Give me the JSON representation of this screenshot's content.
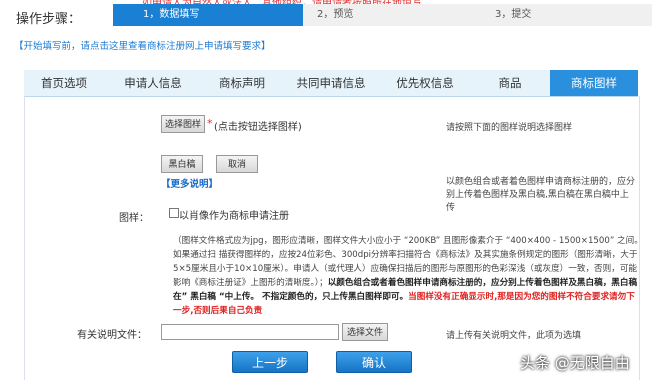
{
  "steps": {
    "label": "操作步骤：",
    "items": [
      "1，数据填写",
      "2，预览",
      "3，提交"
    ],
    "banner_text": "如申请人为自然人或法人、其他组织，请申请者按照所在地填写"
  },
  "hint": "【开始填写前，请点击这里查看商标注册网上申请填写要求】",
  "tabs": [
    "首页选项",
    "申请人信息",
    "商标声明",
    "共同申请信息",
    "优先权信息",
    "商品",
    "商标图样"
  ],
  "active_tab": 6,
  "form": {
    "choose_image_button": "选择图样",
    "required_mark": "*",
    "choose_image_hint": "(点击按钮选择图样)",
    "right_hint_1": "请按照下面的图样说明选择图样",
    "bw_button": "黑白稿",
    "cancel_button": "取消",
    "more_info_link": "【更多说明】",
    "right_hint_2": "以颜色组合或者着色图样申请商标注册的，应分别上传着色图样及黑白稿,黑白稿在黑白稿中上传",
    "image_label": "图样：",
    "portrait_checkbox_label": "以肖像作为商标申请注册",
    "desc_normal": "（图样文件格式应为jpg，图形应清晰，图样文件大小应小于 “200KB” 且图形像素介于 “400×400 - 1500×1500” 之间。如果通过扫 描获得图样的，应按24位彩色、300dpi分辨率扫描符合《商标法》及其实施条例规定的图形（图形清晰，大于5×5厘米且小于10×10厘米）。申请人（或代理人）应确保扫描后的图形与原图形的色彩深浅（或灰度）一致，否则，可能影响《商标注册证》上图形的清晰度。）；",
    "desc_bold": "以颜色组合或者着色图样申请商标注册的，应分别上传着色图样及黑白稿，黑白稿在” 黑白稿 “中上传。 不指定颜色的，只上传黑白图样即可。",
    "desc_red": "当图样没有正确显示时,那是因为您的图样不符合要求请勿下一步,否则后果自己负责",
    "explain_file_label": "有关说明文件：",
    "explain_file_value": "",
    "choose_file_button": "选择文件",
    "right_hint_3": "请上传有关说明文件，此项为选填"
  },
  "nav": {
    "prev": "上一步",
    "confirm": "确认"
  },
  "watermark": "头条 @无限自由",
  "colors": {
    "accent": "#1a80d4",
    "tab_active": "#2a8fdc",
    "link": "#1a7ad4",
    "warning": "#e02020"
  }
}
